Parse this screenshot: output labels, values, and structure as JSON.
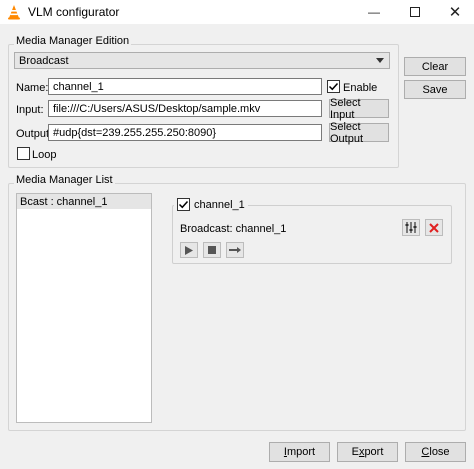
{
  "window": {
    "title": "VLM configurator",
    "icon": "vlc-cone-icon",
    "controls": [
      "minimize-icon",
      "maximize-icon",
      "close-icon"
    ]
  },
  "edition": {
    "group_title": "Media Manager Edition",
    "mode_select": "Broadcast",
    "name_label": "Name:",
    "name_value": "channel_1",
    "enable_label": "Enable",
    "enable_checked": true,
    "input_label": "Input:",
    "input_value": "file:///C:/Users/ASUS/Desktop/sample.mkv",
    "select_input": "Select Input",
    "output_label": "Output:",
    "output_value": "#udp{dst=239.255.255.250:8090}",
    "select_output": "Select Output",
    "loop_label": "Loop",
    "loop_checked": false
  },
  "side_buttons": {
    "clear": "Clear",
    "save": "Save"
  },
  "list": {
    "group_title": "Media Manager List",
    "items": [
      "Bcast : channel_1"
    ],
    "card": {
      "name": "channel_1",
      "checked": true,
      "broadcast_label": "Broadcast: channel_1",
      "icons": [
        "settings-sliders-icon",
        "delete-icon",
        "play-icon",
        "stop-icon",
        "seek-forward-icon"
      ]
    }
  },
  "bottom": {
    "import_prefix": "",
    "import_underline": "I",
    "import_rest": "mport",
    "export_prefix": "E",
    "export_underline": "x",
    "export_rest": "port",
    "close_prefix": "",
    "close_underline": "C",
    "close_rest": "lose"
  },
  "colors": {
    "accent_blue": "#0078d7",
    "delete_red": "#e02020",
    "vlc_orange": "#ff8800"
  }
}
